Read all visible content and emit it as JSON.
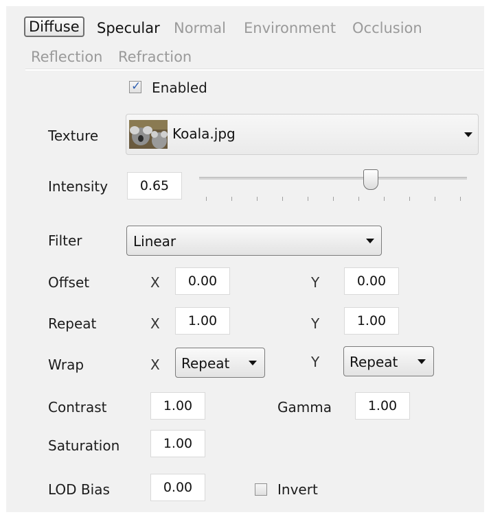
{
  "tabs": [
    {
      "label": "Diffuse",
      "state": "selected"
    },
    {
      "label": "Specular",
      "state": "active"
    },
    {
      "label": "Normal",
      "state": "inactive"
    },
    {
      "label": "Environment",
      "state": "inactive"
    },
    {
      "label": "Occlusion",
      "state": "inactive"
    },
    {
      "label": "Reflection",
      "state": "inactive"
    },
    {
      "label": "Refraction",
      "state": "inactive"
    }
  ],
  "enabled": {
    "label": "Enabled",
    "checked": true
  },
  "texture": {
    "label": "Texture",
    "value": "Koala.jpg"
  },
  "intensity": {
    "label": "Intensity",
    "value": "0.65",
    "slider_fraction": 0.65
  },
  "filter": {
    "label": "Filter",
    "value": "Linear"
  },
  "offset": {
    "label": "Offset",
    "x_label": "X",
    "x": "0.00",
    "y_label": "Y",
    "y": "0.00"
  },
  "repeat": {
    "label": "Repeat",
    "x_label": "X",
    "x": "1.00",
    "y_label": "Y",
    "y": "1.00"
  },
  "wrap": {
    "label": "Wrap",
    "x_label": "X",
    "x": "Repeat",
    "y_label": "Y",
    "y": "Repeat"
  },
  "contrast": {
    "label": "Contrast",
    "value": "1.00"
  },
  "gamma": {
    "label": "Gamma",
    "value": "1.00"
  },
  "saturation": {
    "label": "Saturation",
    "value": "1.00"
  },
  "lod_bias": {
    "label": "LOD Bias",
    "value": "0.00"
  },
  "invert": {
    "label": "Invert",
    "checked": false
  },
  "colors": {
    "panel_bg": "#f1f1f1",
    "accent_check": "#2f5fb0"
  }
}
